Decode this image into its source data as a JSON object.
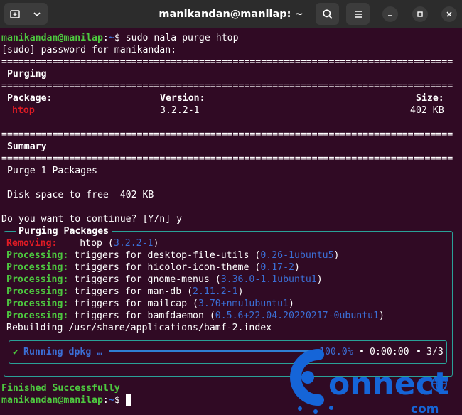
{
  "window": {
    "title": "manikandan@manilap: ~",
    "icons": [
      "new-tab-icon",
      "chevron-down-icon",
      "search-icon",
      "hamburger-menu-icon",
      "minimize-icon",
      "maximize-icon",
      "close-icon"
    ]
  },
  "colors": {
    "background": "#300a24",
    "green": "#4dc73f",
    "red": "#e01b24",
    "blue": "#3b6fd6",
    "teal_border": "#2aa198"
  },
  "terminal": {
    "prompt_user": "manikandan@manilap",
    "prompt_sep": ":",
    "prompt_path": "~",
    "prompt_dollar": "$",
    "command": " sudo nala purge htop",
    "sudo_prompt": "[sudo] password for manikandan:",
    "rule": "================================================================================",
    "purging_header": " Purging",
    "pkg_header_package": " Package:",
    "pkg_header_version": "Version:",
    "pkg_header_size": "Size:",
    "pkg_name": "htop",
    "pkg_version": "3.2.2-1",
    "pkg_size": "402 KB",
    "summary_header": " Summary",
    "summary_line": " Purge 1 Packages",
    "disk_line": " Disk space to free  402 KB",
    "continue_prompt": "Do you want to continue? [Y/n] y",
    "box_title": "Purging Packages",
    "removing_label": "Removing:",
    "removing_pkg": "htop (",
    "removing_ver": "3.2.2-1",
    "close_paren": ")",
    "processing_label": "Processing:",
    "processing": [
      {
        "text": "triggers for desktop-file-utils (",
        "ver": "0.26-1ubuntu5"
      },
      {
        "text": "triggers for hicolor-icon-theme (",
        "ver": "0.17-2"
      },
      {
        "text": "triggers for gnome-menus (",
        "ver": "3.36.0-1.1ubuntu1"
      },
      {
        "text": "triggers for man-db (",
        "ver": "2.11.2-1"
      },
      {
        "text": "triggers for mailcap (",
        "ver": "3.70+nmu1ubuntu1"
      },
      {
        "text": "triggers for bamfdaemon (",
        "ver": "0.5.6+22.04.20220217-0ubuntu1"
      }
    ],
    "rebuilding": "Rebuilding /usr/share/applications/bamf-2.index",
    "progress": {
      "check": "✔",
      "label": "Running dpkg …",
      "percent_text": "100.0%",
      "percent": 100,
      "bullet": "•",
      "elapsed": "0:00:00",
      "count": "3/3"
    },
    "finished": "Finished Successfully"
  },
  "watermark": {
    "text_main": "onnect",
    "text_sub": "com"
  }
}
